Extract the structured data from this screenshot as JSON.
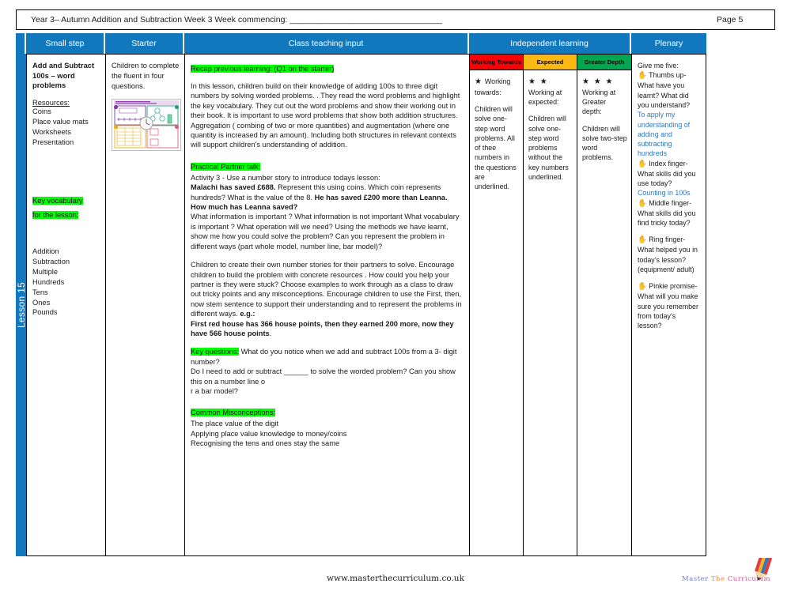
{
  "header": {
    "title": "Year 3– Autumn Addition and Subtraction Week 3   Week  commencing: _________________________________",
    "page_label": "Page 5"
  },
  "spine": {
    "lesson_label": "Lesson 15"
  },
  "columns": {
    "small_step": "Small step",
    "starter": "Starter",
    "class_input": "Class teaching input",
    "independent": "Independent learning",
    "plenary": "Plenary"
  },
  "small_step": {
    "title": "Add and Subtract 100s – word problems",
    "resources_heading": "Resources:",
    "resources": [
      "Coins",
      "Place value mats",
      "Worksheets",
      "Presentation"
    ],
    "vocab_heading_line1": "Key vocabulary",
    "vocab_heading_line2": "for the lesson:",
    "vocabulary": [
      "Addition",
      "Subtraction",
      "Multiple",
      "Hundreds",
      "Tens",
      "Ones",
      "Pounds"
    ]
  },
  "starter": {
    "text": "Children to complete the fluent in four questions.",
    "thumbnail_name": "fluent-in-four-worksheet-thumbnail"
  },
  "class_input": {
    "recap_heading": "Recap previous learning: (Q1 on the starter)",
    "recap_body": "In this lesson, children build on their knowledge of adding 100s to three digit numbers by solving worded problems. .  They read the word problems and highlight the key vocabulary. They cut out the word problems and show their working out in their book.  It is important to use word problems that show both addition structures. Aggregation ( combing of two or more quantities) and augmentation (where one quantity is increased by an amount).  Including both structures in relevant contexts will support children's understanding of addition.",
    "partner_heading": "Practical Partner talk:",
    "partner_intro": "Activity 3 - Use a number story to introduce todays lesson:",
    "partner_bold_1": "Malachi has saved £688.",
    "partner_plain_1": " Represent this using coins. Which coin represents hundreds?  What is the value of the 8.  ",
    "partner_bold_2": "He has saved £200 more than Leanna. How much has Leanna saved?",
    "partner_questions": "What information is important ? What information is not important  What vocabulary is important ?  What operation will we need?  Using the methods we have learnt, show me how you could solve the problem?  Can you represent the problem in different ways  (part whole model, number line, bar model)?",
    "stories_body": "Children to create their own number stories for their partners to solve. Encourage children to build the problem with concrete resources .  How could you help your partner is they were stuck? Choose examples to work through as a class to draw out tricky points and any misconceptions. Encourage children to use the First, then, now stem sentence to support their understanding and to represent the problems in different ways.   ",
    "eg_label": "e.g.:",
    "eg_bold": "First red house has 366 house points, then they earned 200 more, now they have 566 house points",
    "eg_tail": ".",
    "key_questions_heading": "Key questions:",
    "key_questions_line1": " What do you notice when we add and subtract 100s from a 3- digit number?",
    "key_questions_line2": "Do I need to add or subtract ______ to solve the worded problem? Can you show this on a number line o",
    "key_questions_line3": "r a bar model?",
    "misconceptions_heading": "Common Misconceptions:",
    "misconceptions": [
      "The place value of the digit",
      "Applying place value knowledge to money/coins",
      "Recognising the tens and ones stay the same"
    ]
  },
  "independent": [
    {
      "band": "Working Towards",
      "band_color": "#fb0007",
      "stars": "★",
      "lead": " Working towards:",
      "body": "Children will solve one-step word problems. All of thee numbers in the questions are underlined."
    },
    {
      "band": "Expected",
      "band_color": "#fcb913",
      "stars": "★ ★",
      "lead": " Working at expected:",
      "body": "Children will solve one-step word problems without the key numbers underlined."
    },
    {
      "band": "Greater Depth",
      "band_color": "#00a750",
      "stars": "★ ★ ★",
      "lead": "Working at Greater depth:",
      "body": "Children will solve two-step word problems."
    }
  ],
  "plenary": {
    "intro": "Give me five:",
    "items": [
      {
        "icon": "hand-icon",
        "text": " Thumbs up- What have you learnt? What did you understand?",
        "answer": "To apply my understanding of adding and subtracting hundreds",
        "answer_color": "#2e79c0"
      },
      {
        "icon": "hand-icon",
        "text": " Index finger- What skills did you use today?",
        "answer": "Counting in 100s",
        "answer_color": "#2e79c0"
      },
      {
        "icon": "hand-icon",
        "text": " Middle finger- What skills did you find tricky today?",
        "answer": "",
        "answer_color": "#2e79c0"
      },
      {
        "icon": "hand-icon",
        "text": " Ring finger- What helped you in today’s lesson? (equipment/ adult)",
        "answer": "",
        "answer_color": "#2e79c0"
      },
      {
        "icon": "hand-icon",
        "text": " Pinkie promise- What will you make sure you remember from today’s lesson?",
        "answer": "",
        "answer_color": "#2e79c0"
      }
    ]
  },
  "footer": {
    "url": "www.masterthecurriculum.co.uk",
    "logo_word_1": "Master",
    "logo_word_2": "The",
    "logo_word_3": "Curriculum"
  }
}
